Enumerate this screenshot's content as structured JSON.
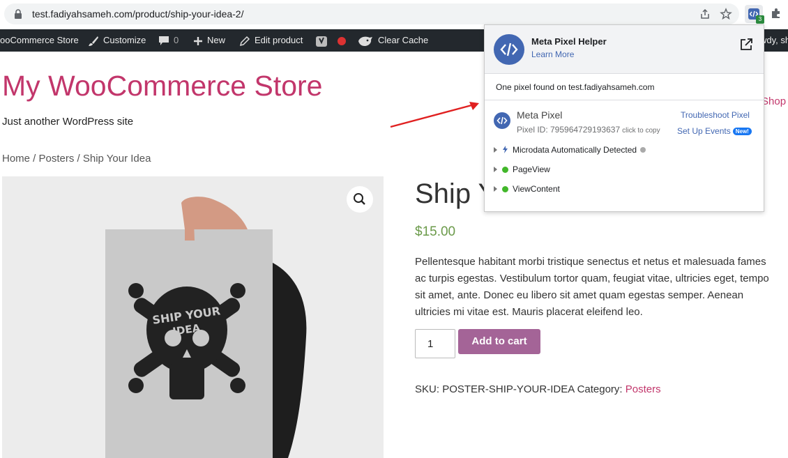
{
  "browser": {
    "url": "test.fadiyahsameh.com/product/ship-your-idea-2/",
    "extension_badge": "3"
  },
  "adminbar": {
    "site": "ooCommerce Store",
    "customize": "Customize",
    "comments": "0",
    "new": "New",
    "edit_product": "Edit product",
    "clear_cache": "Clear Cache",
    "howdy": "wdy, sh"
  },
  "site": {
    "title": "My WooCommerce Store",
    "tagline": "Just another WordPress site",
    "nav_shop": "Shop"
  },
  "breadcrumb": "Home / Posters / Ship Your Idea",
  "product": {
    "title": "Ship Y",
    "price": "$15.00",
    "description_lines": [
      "Pellentesque habitant morbi tristique senectus et netus et malesuada fames",
      "ac turpis egestas. Vestibulum tortor quam, feugiat vitae, ultricies eget, tempo",
      "sit amet, ante. Donec eu libero sit amet quam egestas semper. Aenean",
      "ultricies mi vitae est. Mauris placerat eleifend leo."
    ],
    "quantity": "1",
    "add_to_cart": "Add to cart",
    "sku_label": "SKU:",
    "sku": "POSTER-SHIP-YOUR-IDEA",
    "category_label": "Category:",
    "category": "Posters",
    "poster_text": "SHIP YOUR IDEA"
  },
  "pixel_helper": {
    "title": "Meta Pixel Helper",
    "learn_more": "Learn More",
    "found": "One pixel found on test.fadiyahsameh.com",
    "pixel_name": "Meta Pixel",
    "pixel_id": "Pixel ID: 795964729193637",
    "click_to_copy": "click to copy",
    "troubleshoot": "Troubleshoot Pixel",
    "setup_events": "Set Up Events",
    "new_badge": "New!",
    "events": [
      "Microdata Automatically Detected",
      "PageView",
      "ViewContent"
    ]
  },
  "colors": {
    "brand": "#c2366b",
    "button": "#a46497",
    "price": "#6b9a4a",
    "meta_blue": "#4267b2"
  }
}
